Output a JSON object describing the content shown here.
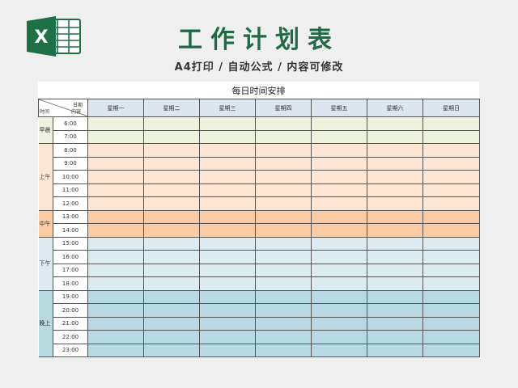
{
  "header": {
    "title": "工作计划表",
    "subtitle": "A4打印 / 自动公式 / 内容可修改"
  },
  "logo": {
    "icon": "excel-icon",
    "letter": "X",
    "color": "#1e7145"
  },
  "sheet": {
    "title": "每日时间安排",
    "corner": {
      "top_right": "日期",
      "bottom_left": "时间",
      "bottom_right": "内容"
    },
    "days": [
      "星期一",
      "星期二",
      "星期三",
      "星期四",
      "星期五",
      "星期六",
      "星期日"
    ],
    "periods": [
      {
        "key": "morning",
        "label": "早晨",
        "color": "#edf2df",
        "times": [
          "6:00",
          "7:00"
        ]
      },
      {
        "key": "am",
        "label": "上午",
        "color": "#fde5d3",
        "times": [
          "8:00",
          "9:00",
          "10:00",
          "11:00",
          "12:00"
        ]
      },
      {
        "key": "noon",
        "label": "中午",
        "color": "#fbcba6",
        "times": [
          "13:00",
          "14:00"
        ]
      },
      {
        "key": "pm",
        "label": "下午",
        "color": "#dcebf0",
        "times": [
          "15:00",
          "16:00",
          "17:00",
          "18:00"
        ]
      },
      {
        "key": "eve",
        "label": "晚上",
        "color": "#b6d9e2",
        "times": [
          "19:00",
          "20:00",
          "21:00",
          "22:00",
          "23:00"
        ]
      }
    ]
  }
}
